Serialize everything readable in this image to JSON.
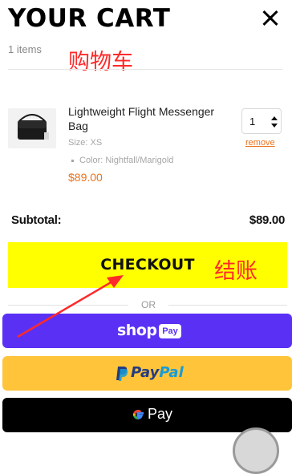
{
  "header": {
    "title": "YOUR CART",
    "item_count": "1 items",
    "close_icon": "close-icon"
  },
  "annotations": {
    "cart": "购物车",
    "checkout": "结账"
  },
  "item": {
    "name": "Lightweight Flight Messenger Bag",
    "size": "Size: XS",
    "color": "Color: Nightfall/Marigold",
    "price": "$89.00",
    "quantity": "1",
    "remove_label": "remove"
  },
  "summary": {
    "subtotal_label": "Subtotal:",
    "subtotal_value": "$89.00"
  },
  "checkout": {
    "label": "CHECKOUT"
  },
  "divider_text": "OR",
  "express": {
    "shop_word": "shop",
    "shop_pay_pill": "Pay",
    "paypal_part1": "Pay",
    "paypal_part2": "Pal",
    "gpay_word": "Pay"
  },
  "colors": {
    "accent_price": "#e9731e",
    "checkout_bg": "#ffff00",
    "shop_pay": "#5a31f4",
    "paypal": "#ffc439",
    "gpay": "#000000",
    "annotation": "#ff2a2a"
  }
}
